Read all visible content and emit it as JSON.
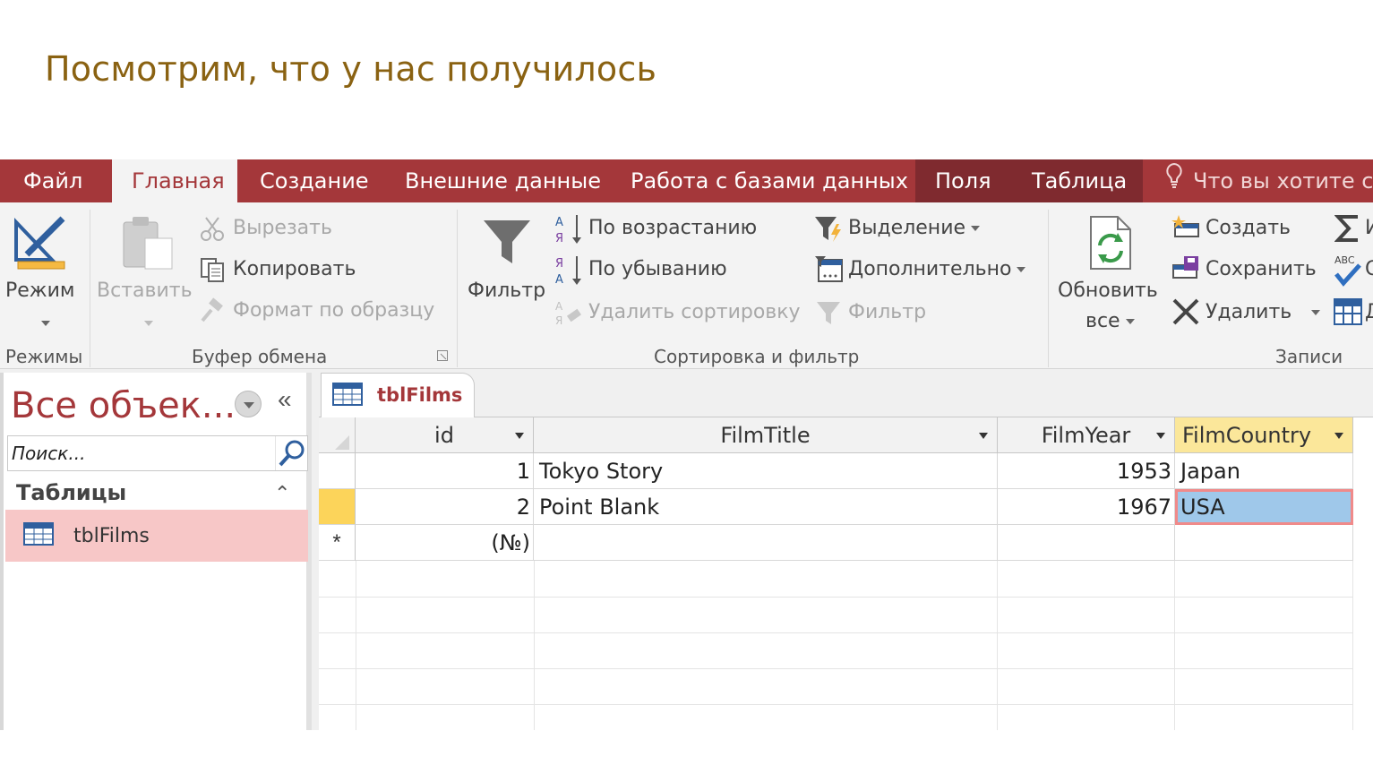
{
  "slide": {
    "title": "Посмотрим, что у нас получилось"
  },
  "tabs": [
    {
      "label": "Файл"
    },
    {
      "label": "Главная"
    },
    {
      "label": "Создание"
    },
    {
      "label": "Внешние данные"
    },
    {
      "label": "Работа с базами данных"
    },
    {
      "label": "Поля"
    },
    {
      "label": "Таблица"
    }
  ],
  "tell_me": "Что вы хотите сд",
  "ribbon": {
    "views": {
      "mode": "Режим",
      "group": "Режимы"
    },
    "clipboard": {
      "paste": "Вставить",
      "cut": "Вырезать",
      "copy": "Копировать",
      "format_painter": "Формат по образцу",
      "group": "Буфер обмена"
    },
    "sort_filter": {
      "filter": "Фильтр",
      "ascending": "По возрастанию",
      "descending": "По убыванию",
      "remove_sort": "Удалить сортировку",
      "selection": "Выделение",
      "advanced": "Дополнительно",
      "toggle_filter": "Фильтр",
      "group": "Сортировка и фильтр"
    },
    "records": {
      "refresh_line1": "Обновить",
      "refresh_line2": "все",
      "new": "Создать",
      "save": "Сохранить",
      "delete": "Удалить",
      "group": "Записи",
      "totals_partial": "И",
      "spelling_partial": "С",
      "more_partial": "Д",
      "spelling_badge": "ABC"
    }
  },
  "nav": {
    "title": "Все объек...",
    "collapse": "«",
    "search_placeholder": "Поиск...",
    "group": "Таблицы",
    "group_chevron": "⌃",
    "items": [
      {
        "label": "tblFilms"
      }
    ]
  },
  "document": {
    "tab_label": "tblFilms",
    "columns": [
      "id",
      "FilmTitle",
      "FilmYear",
      "FilmCountry"
    ],
    "rows": [
      {
        "id": "1",
        "title": "Tokyo Story",
        "year": "1953",
        "country": "Japan"
      },
      {
        "id": "2",
        "title": "Point Blank",
        "year": "1967",
        "country": "USA"
      }
    ],
    "new_row_marker": "*",
    "new_row_id": "(№)"
  },
  "colors": {
    "accent": "#a4373a",
    "accent_dark": "#7f2a2f",
    "slide_title": "#8a6212",
    "selected_header": "#fbe79a",
    "current_row": "#fcd45a",
    "active_cell": "#9fc8ea",
    "nav_selected": "#f7c7c7"
  }
}
